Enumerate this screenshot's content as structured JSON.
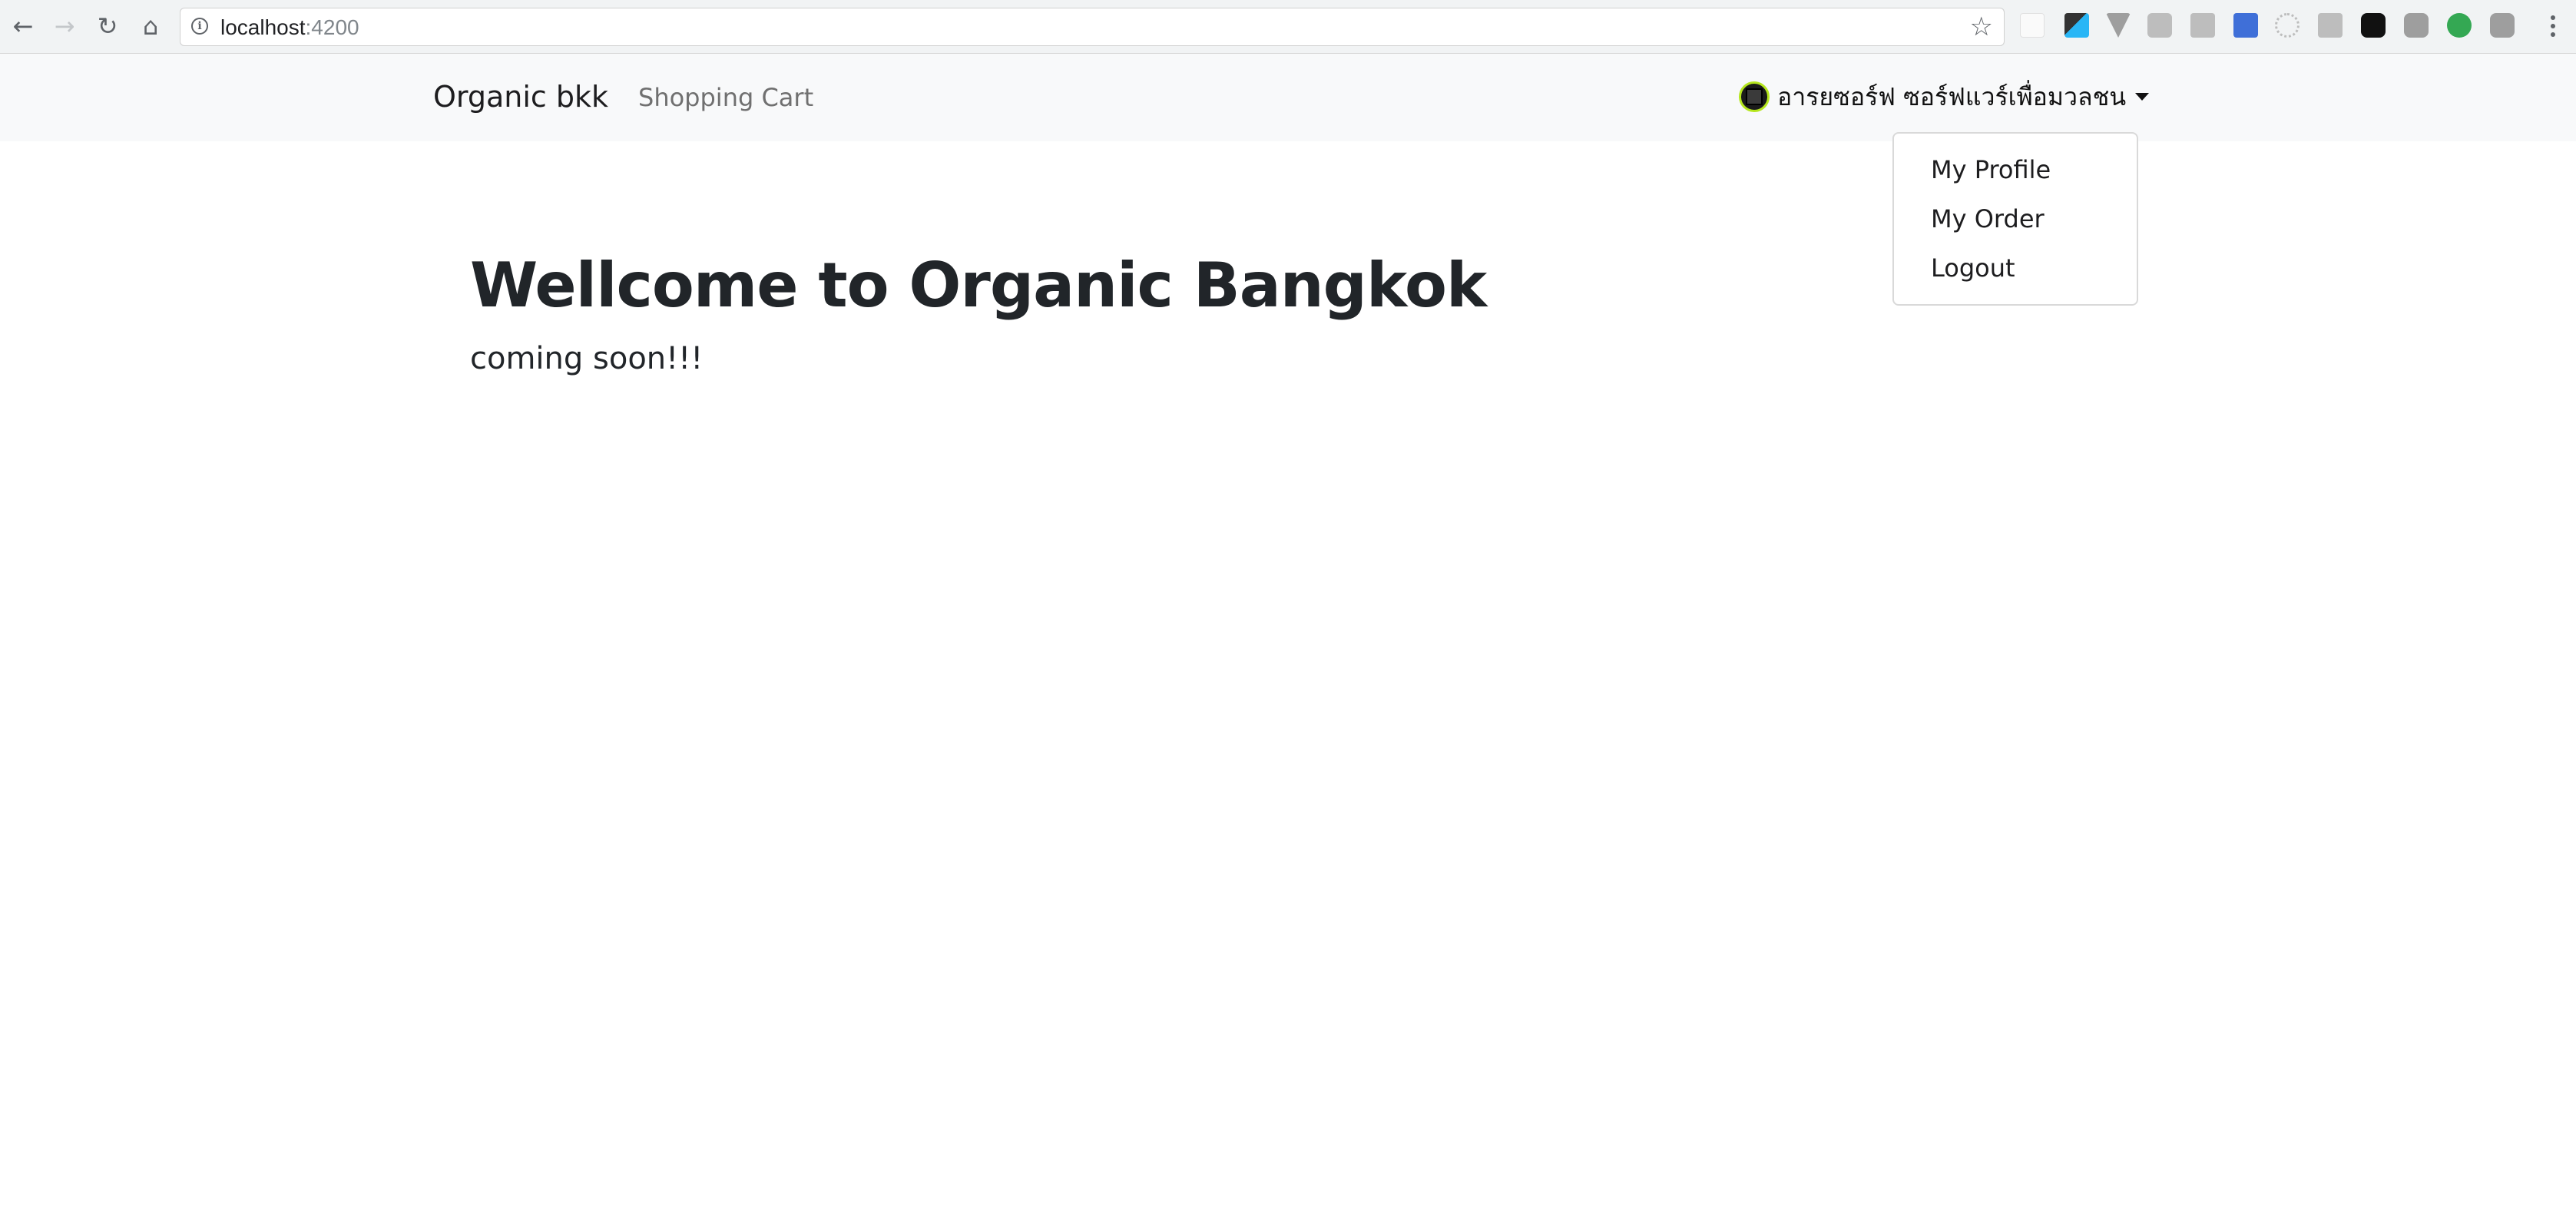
{
  "browser": {
    "url_host": "localhost",
    "url_port": ":4200",
    "icons": {
      "back": "arrow-left-icon",
      "forward": "arrow-right-icon",
      "reload": "reload-icon",
      "home": "home-icon",
      "info": "info-icon",
      "bookmark": "star-icon",
      "menu": "more-vert-icon"
    }
  },
  "navbar": {
    "brand": "Organic bkk",
    "links": [
      {
        "label": "Shopping Cart"
      }
    ],
    "user": {
      "name": "อารยซอร์ฟ ซอร์ฟแวร์เพื่อมวลชน"
    }
  },
  "dropdown": {
    "items": [
      {
        "label": "My Profile"
      },
      {
        "label": "My Order"
      },
      {
        "label": "Logout"
      }
    ]
  },
  "main": {
    "heading": "Wellcome to Organic Bangkok",
    "subtext": "coming soon!!!"
  },
  "colors": {
    "navbar_bg": "#f8f9fa",
    "chrome_bg": "#f1f3f4",
    "text": "#212529",
    "link_muted": "#707070"
  }
}
